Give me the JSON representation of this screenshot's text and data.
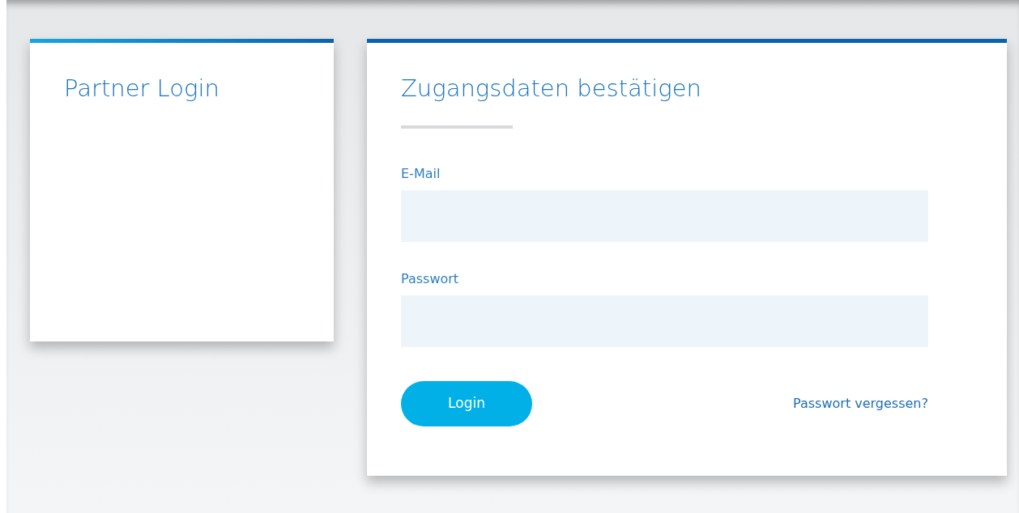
{
  "partner_card": {
    "title": "Partner Login"
  },
  "login_card": {
    "title": "Zugangsdaten bestätigen",
    "fields": [
      {
        "label": "E-Mail"
      },
      {
        "label": "Passwort"
      }
    ],
    "login_button": "Login",
    "forgot_link": "Passwort vergessen?"
  }
}
